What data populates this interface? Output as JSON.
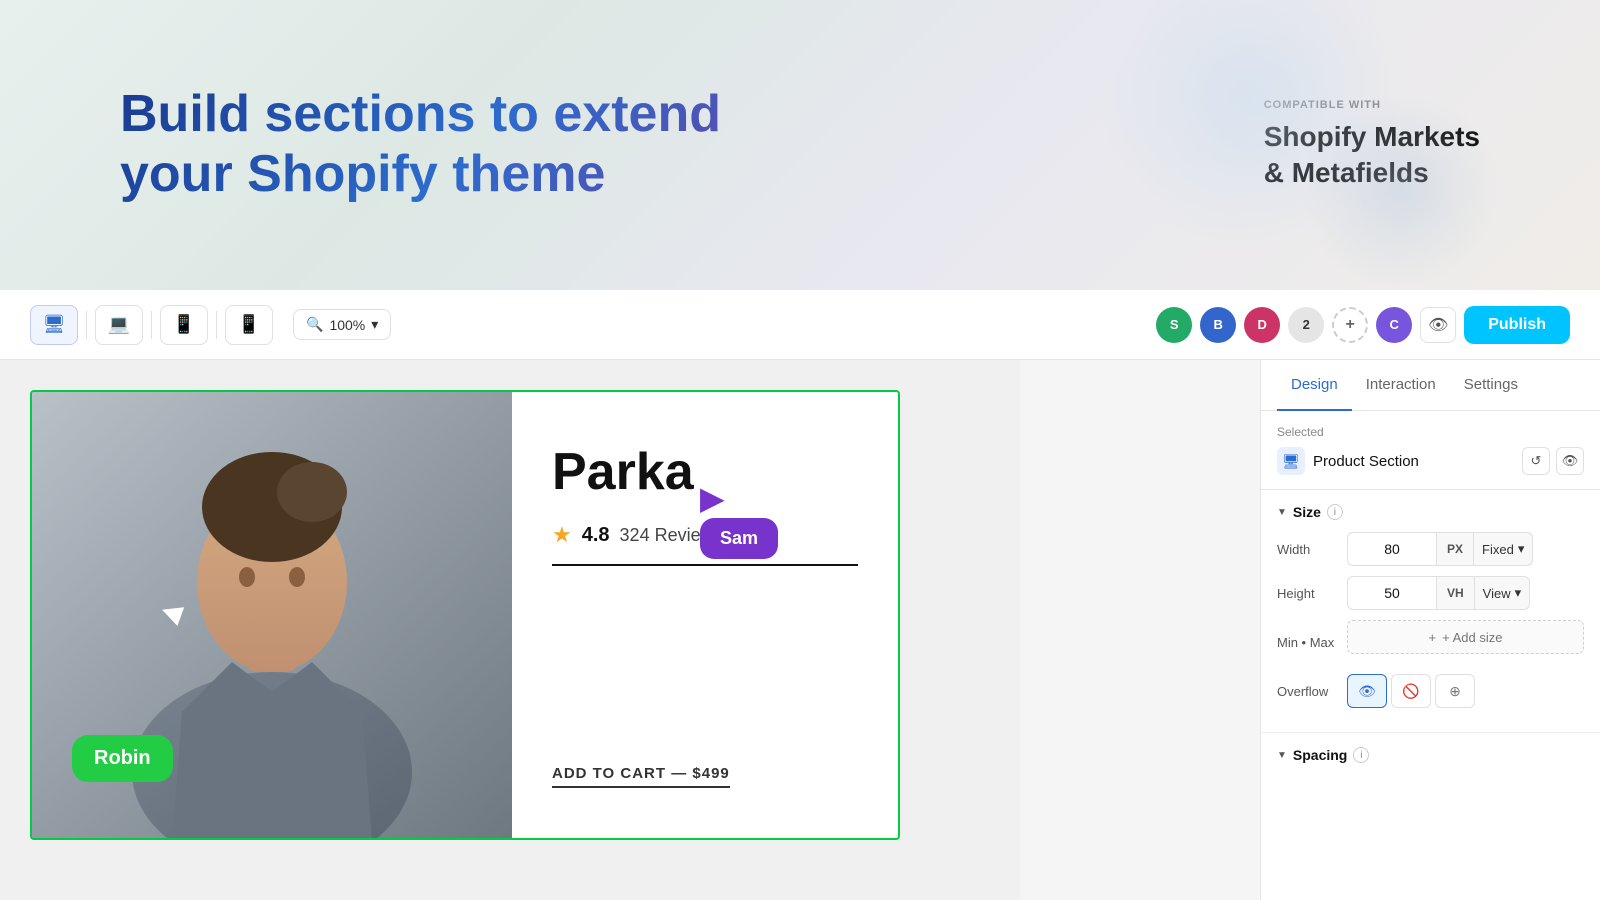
{
  "hero": {
    "title": "Build sections to extend your Shopify theme",
    "compatible_label": "COMPATIBLE WITH",
    "compatible_value": "Shopify Markets & Metafields"
  },
  "toolbar": {
    "zoom": "100%",
    "devices": [
      "desktop",
      "laptop",
      "tablet",
      "mobile"
    ],
    "avatars": [
      {
        "label": "S",
        "color": "#22aa66"
      },
      {
        "label": "B",
        "color": "#3366cc"
      },
      {
        "label": "D",
        "color": "#cc3366"
      },
      {
        "label": "2",
        "color": "#e5e5e5"
      },
      {
        "label": "+",
        "color": "transparent"
      },
      {
        "label": "C",
        "color": "#7755dd"
      }
    ],
    "publish_label": "Publish"
  },
  "panel": {
    "tabs": [
      "Design",
      "Interaction",
      "Settings"
    ],
    "active_tab": "Design",
    "selected_label": "Selected",
    "selected_item": "Product Section",
    "size_section": {
      "title": "Size",
      "width_label": "Width",
      "width_value": "80",
      "width_unit": "PX",
      "width_mode": "Fixed",
      "height_label": "Height",
      "height_value": "50",
      "height_unit": "VH",
      "height_mode": "View",
      "min_max_label": "Min • Max",
      "add_size_label": "+ Add size"
    },
    "overflow_section": {
      "label": "Overflow"
    },
    "spacing_section": {
      "title": "Spacing"
    }
  },
  "product": {
    "name": "Parka",
    "rating": "4.8",
    "reviews": "324 Reviews",
    "add_to_cart": "ADD TO CART — $499"
  },
  "cursors": {
    "robin_label": "Robin",
    "sam_label": "Sam"
  }
}
